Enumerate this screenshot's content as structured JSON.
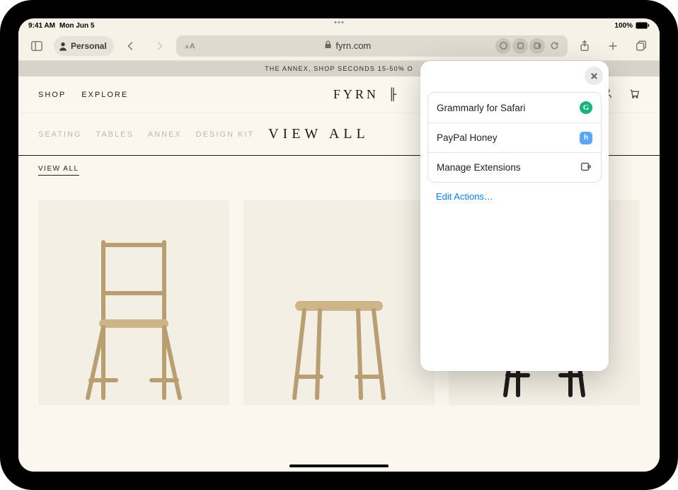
{
  "status": {
    "time": "9:41 AM",
    "date": "Mon Jun 5",
    "battery_pct": "100%"
  },
  "toolbar": {
    "profile_label": "Personal",
    "url_display": "fyrn.com"
  },
  "popover": {
    "items": [
      {
        "label": "Grammarly for Safari",
        "badge_letter": "G",
        "badge_class": "badge-g"
      },
      {
        "label": "PayPal Honey",
        "badge_letter": "h",
        "badge_class": "badge-h"
      }
    ],
    "manage_label": "Manage Extensions",
    "edit_label": "Edit Actions…"
  },
  "page": {
    "banner": "THE ANNEX, SHOP SECONDS 15-50% O",
    "nav": {
      "shop": "SHOP",
      "explore": "EXPLORE"
    },
    "brand": "FYRN",
    "brand_mark_char": "╟",
    "categories": [
      {
        "label": "SEATING"
      },
      {
        "label": "TABLES"
      },
      {
        "label": "ANNEX"
      },
      {
        "label": "DESIGN KIT"
      }
    ],
    "active_category": "VIEW ALL",
    "sub_filter": "VIEW ALL"
  }
}
